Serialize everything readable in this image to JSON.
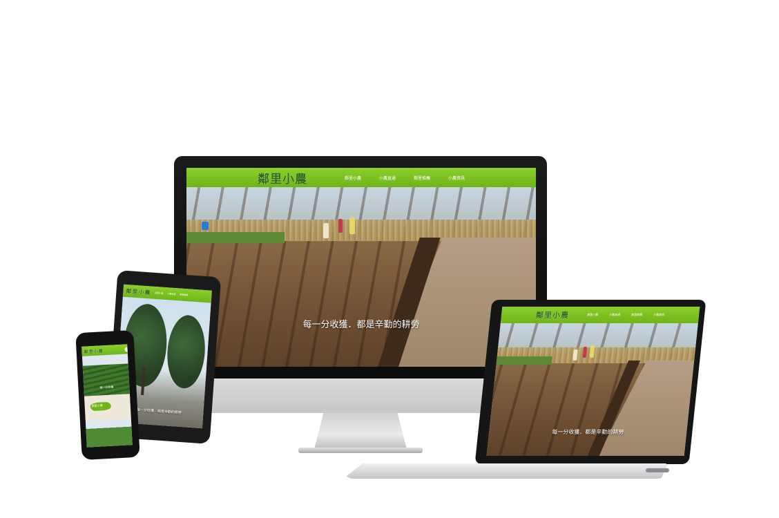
{
  "brand": {
    "logo": "鄰里小農"
  },
  "nav": {
    "items": [
      {
        "label": "鄰里小農"
      },
      {
        "label": "小農直通"
      },
      {
        "label": "鄰里推薦"
      },
      {
        "label": "小農資訊"
      }
    ]
  },
  "hero": {
    "caption": "每一分收獲．都是辛勤的耕勞"
  },
  "tablet": {
    "caption": "每一分收獲．都是辛勤的耕勞"
  },
  "phone": {
    "caption": "每一分收獲",
    "tag": "鄰里小農"
  },
  "colors": {
    "nav_green": "#7cc321",
    "logo_green": "#2f6b12",
    "device_black": "#151515",
    "silver": "#d0d1d3"
  },
  "icons": [
    "monitor-icon",
    "laptop-icon",
    "tablet-icon",
    "phone-icon",
    "hamburger-menu-icon"
  ]
}
